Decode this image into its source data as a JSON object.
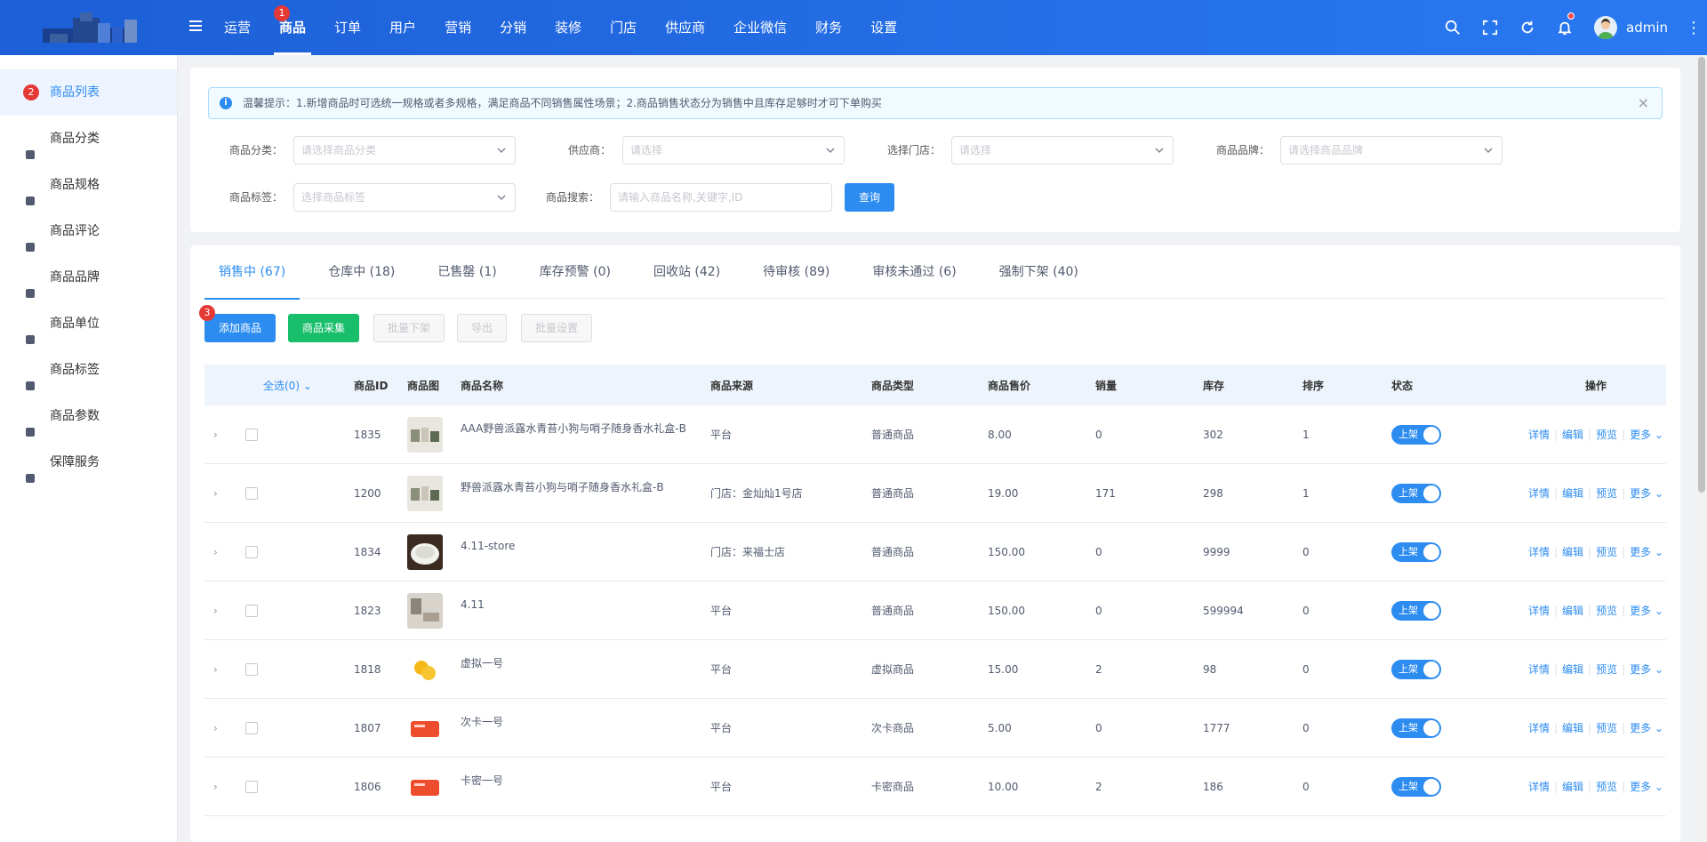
{
  "header": {
    "nav": [
      "运营",
      "商品",
      "订单",
      "用户",
      "营销",
      "分销",
      "装修",
      "门店",
      "供应商",
      "企业微信",
      "财务",
      "设置"
    ],
    "active_nav": 1,
    "nav_badge": "1",
    "user": "admin"
  },
  "sidebar": {
    "items": [
      "商品列表",
      "商品分类",
      "商品规格",
      "商品评论",
      "商品品牌",
      "商品单位",
      "商品标签",
      "商品参数",
      "保障服务"
    ],
    "badge": "2"
  },
  "notice": "温馨提示：1.新增商品时可选统一规格或者多规格，满足商品不同销售属性场景；2.商品销售状态分为销售中且库存足够时才可下单购买",
  "filters": {
    "category_label": "商品分类：",
    "category_placeholder": "请选择商品分类",
    "supplier_label": "供应商：",
    "supplier_placeholder": "请选择",
    "store_label": "选择门店：",
    "store_placeholder": "请选择",
    "brand_label": "商品品牌：",
    "brand_placeholder": "请选择商品品牌",
    "tag_label": "商品标签：",
    "tag_placeholder": "选择商品标签",
    "search_label": "商品搜索：",
    "search_placeholder": "请输入商品名称,关键字,ID",
    "query_button": "查询"
  },
  "tabs": [
    "销售中 (67)",
    "仓库中 (18)",
    "已售罄 (1)",
    "库存预警 (0)",
    "回收站 (42)",
    "待审核 (89)",
    "审核未通过 (6)",
    "强制下架 (40)"
  ],
  "toolbar": {
    "add": "添加商品",
    "collect": "商品采集",
    "batch_off": "批量下架",
    "export": "导出",
    "batch_set": "批量设置",
    "badge": "3"
  },
  "table": {
    "select_all": "全选(0)",
    "headers": {
      "id": "商品ID",
      "img": "商品图",
      "name": "商品名称",
      "source": "商品来源",
      "type": "商品类型",
      "price": "商品售价",
      "sales": "销量",
      "stock": "库存",
      "sort": "排序",
      "status": "状态",
      "ops": "操作"
    },
    "status_on": "上架",
    "ops": {
      "detail": "详情",
      "edit": "编辑",
      "preview": "预览",
      "more": "更多"
    },
    "rows": [
      {
        "id": "1835",
        "name": "AAA野兽派露水青苔小狗与哨子随身香水礼盒-B",
        "source": "平台",
        "type": "普通商品",
        "price": "8.00",
        "sales": "0",
        "stock": "302",
        "sort": "1",
        "img": "gift-box"
      },
      {
        "id": "1200",
        "name": "野兽派露水青苔小狗与哨子随身香水礼盒-B",
        "source": "门店：金灿灿1号店",
        "type": "普通商品",
        "price": "19.00",
        "sales": "171",
        "stock": "298",
        "sort": "1",
        "img": "gift-box"
      },
      {
        "id": "1834",
        "name": "4.11-store",
        "source": "门店：来福士店",
        "type": "普通商品",
        "price": "150.00",
        "sales": "0",
        "stock": "9999",
        "sort": "0",
        "img": "bowl"
      },
      {
        "id": "1823",
        "name": "4.11",
        "source": "平台",
        "type": "普通商品",
        "price": "150.00",
        "sales": "0",
        "stock": "599994",
        "sort": "0",
        "img": "interior"
      },
      {
        "id": "1818",
        "name": "虚拟一号",
        "source": "平台",
        "type": "虚拟商品",
        "price": "15.00",
        "sales": "2",
        "stock": "98",
        "sort": "0",
        "img": "coins"
      },
      {
        "id": "1807",
        "name": "次卡一号",
        "source": "平台",
        "type": "次卡商品",
        "price": "5.00",
        "sales": "0",
        "stock": "1777",
        "sort": "0",
        "img": "card"
      },
      {
        "id": "1806",
        "name": "卡密一号",
        "source": "平台",
        "type": "卡密商品",
        "price": "10.00",
        "sales": "2",
        "stock": "186",
        "sort": "0",
        "img": "card"
      }
    ]
  }
}
